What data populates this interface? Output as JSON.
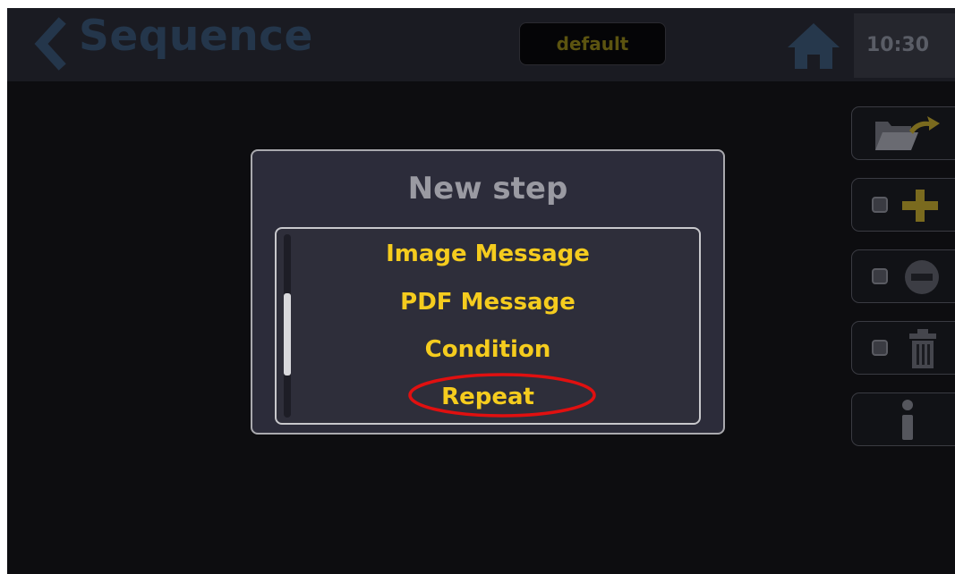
{
  "header": {
    "title": "Sequence",
    "badge": "default",
    "time": "10:30"
  },
  "dialog": {
    "title": "New step",
    "items": [
      {
        "label": "Image Message"
      },
      {
        "label": "PDF Message"
      },
      {
        "label": "Condition"
      },
      {
        "label": "Repeat",
        "highlighted": true
      }
    ]
  },
  "toolbar": {
    "buttons": [
      {
        "icon": "open-folder-icon"
      },
      {
        "icon": "add-icon"
      },
      {
        "icon": "remove-icon"
      },
      {
        "icon": "trash-icon"
      },
      {
        "icon": "info-icon"
      }
    ]
  },
  "colors": {
    "accent_yellow": "#f5cc1e",
    "highlight_ring": "#e01010",
    "dialog_background": "#2c2c3a"
  }
}
